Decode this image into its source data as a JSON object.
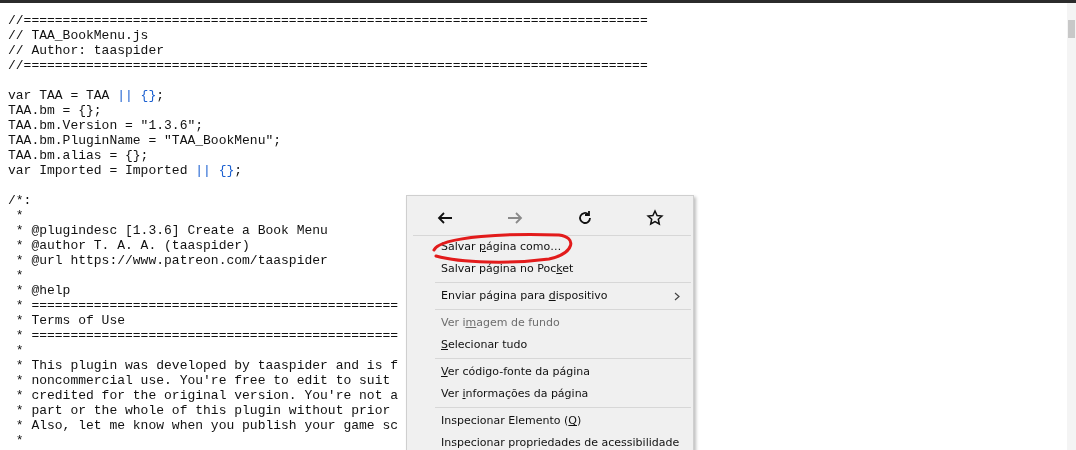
{
  "code_blocks": [
    [
      [
        {
          "text": "//================================================================================",
          "kind": "plain"
        }
      ],
      [
        {
          "text": "// TAA_BookMenu.js",
          "kind": "plain"
        }
      ],
      [
        {
          "text": "// Author: taaspider",
          "kind": "plain"
        }
      ],
      [
        {
          "text": "//================================================================================",
          "kind": "plain"
        }
      ]
    ],
    [
      [
        {
          "text": "var TAA = TAA ",
          "kind": "plain"
        },
        {
          "text": "|| {}",
          "kind": "op"
        },
        {
          "text": ";",
          "kind": "plain"
        }
      ],
      [
        {
          "text": "TAA.bm = {};",
          "kind": "plain"
        }
      ],
      [
        {
          "text": "TAA.bm.Version = \"1.3.6\";",
          "kind": "plain"
        }
      ],
      [
        {
          "text": "TAA.bm.PluginName = \"TAA_BookMenu\";",
          "kind": "plain"
        }
      ],
      [
        {
          "text": "TAA.bm.alias = {};",
          "kind": "plain"
        }
      ],
      [
        {
          "text": "var Imported = Imported ",
          "kind": "plain"
        },
        {
          "text": "|| {}",
          "kind": "op"
        },
        {
          "text": ";",
          "kind": "plain"
        }
      ]
    ],
    [
      [
        {
          "text": "/*:",
          "kind": "plain"
        }
      ],
      [
        {
          "text": " *",
          "kind": "plain"
        }
      ],
      [
        {
          "text": " * @plugindesc [1.3.6] Create a Book Menu",
          "kind": "plain"
        }
      ],
      [
        {
          "text": " * @author T. A. A. (taaspider)",
          "kind": "plain"
        }
      ],
      [
        {
          "text": " * @url https://www.patreon.com/taaspider",
          "kind": "plain"
        }
      ],
      [
        {
          "text": " *",
          "kind": "plain"
        }
      ],
      [
        {
          "text": " * @help",
          "kind": "plain"
        }
      ],
      [
        {
          "text": " * ===============================================",
          "kind": "plain"
        }
      ],
      [
        {
          "text": " * Terms of Use",
          "kind": "plain"
        }
      ],
      [
        {
          "text": " * ===============================================",
          "kind": "plain"
        }
      ],
      [
        {
          "text": " *",
          "kind": "plain"
        }
      ],
      [
        {
          "text": " * This plugin was developed by taaspider and is f",
          "kind": "plain"
        }
      ],
      [
        {
          "text": " * noncommercial use. You're free to edit to suit",
          "kind": "plain"
        }
      ],
      [
        {
          "text": " * credited for the original version. You're not a",
          "kind": "plain"
        }
      ],
      [
        {
          "text": " * part or the whole of this plugin without prior",
          "kind": "plain"
        }
      ],
      [
        {
          "text": " * Also, let me know when you publish your game sc",
          "kind": "plain"
        }
      ],
      [
        {
          "text": " *",
          "kind": "plain"
        }
      ]
    ]
  ],
  "context_menu": {
    "nav": [
      {
        "kind": "back",
        "disabled": false
      },
      {
        "kind": "forward",
        "disabled": true
      },
      {
        "kind": "reload",
        "disabled": false
      },
      {
        "kind": "bookmark",
        "disabled": false
      }
    ],
    "groups": [
      [
        {
          "before": "Salvar ",
          "key": "p",
          "after": "ágina como…",
          "disabled": false,
          "submenu": false,
          "circled": true
        },
        {
          "before": "Salvar página no Poc",
          "key": "k",
          "after": "et",
          "disabled": false,
          "submenu": false,
          "circled": false
        }
      ],
      [
        {
          "before": "Enviar página para ",
          "key": "d",
          "after": "ispositivo",
          "disabled": false,
          "submenu": true,
          "circled": false
        }
      ],
      [
        {
          "before": "Ver i",
          "key": "m",
          "after": "agem de fundo",
          "disabled": true,
          "submenu": false,
          "circled": false
        },
        {
          "key": "S",
          "after": "elecionar tudo",
          "disabled": false,
          "submenu": false,
          "circled": false
        }
      ],
      [
        {
          "key": "V",
          "after": "er código-fonte da página",
          "disabled": false,
          "submenu": false,
          "circled": false
        },
        {
          "before": "Ver ",
          "key": "i",
          "after": "nformações da página",
          "disabled": false,
          "submenu": false,
          "circled": false
        }
      ],
      [
        {
          "before": "Inspecionar Elemento (",
          "key": "Q",
          "after": ")",
          "disabled": false,
          "submenu": false,
          "circled": false
        },
        {
          "before": "Inspecionar propriedades de acessibilidade",
          "disabled": false,
          "submenu": false,
          "circled": false
        }
      ]
    ]
  }
}
